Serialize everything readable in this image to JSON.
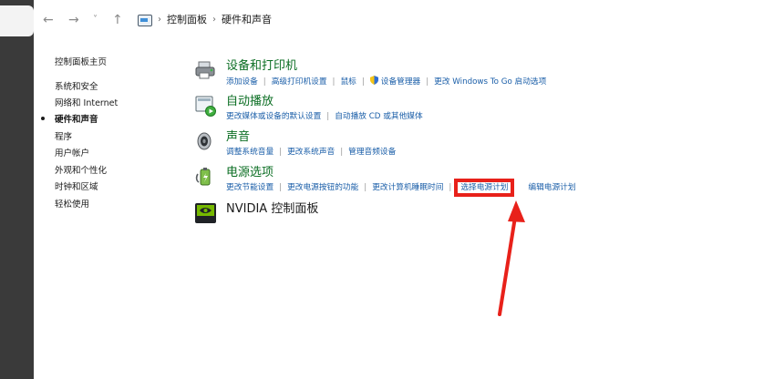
{
  "window": {
    "breadcrumb": [
      "控制面板",
      "硬件和声音"
    ],
    "nav": {
      "back": "←",
      "forward": "→",
      "recent": "˅",
      "up": "↑"
    }
  },
  "sidebar": {
    "items": [
      {
        "label": "控制面板主页",
        "current": false
      },
      {
        "label": "系统和安全",
        "current": false
      },
      {
        "label": "网络和 Internet",
        "current": false
      },
      {
        "label": "硬件和声音",
        "current": true
      },
      {
        "label": "程序",
        "current": false
      },
      {
        "label": "用户帐户",
        "current": false
      },
      {
        "label": "外观和个性化",
        "current": false
      },
      {
        "label": "时钟和区域",
        "current": false
      },
      {
        "label": "轻松使用",
        "current": false
      }
    ]
  },
  "categories": [
    {
      "title": "设备和打印机",
      "icon": "printer-icon",
      "links": [
        "添加设备",
        "高级打印机设置",
        "鼠标",
        "设备管理器",
        "更改 Windows To Go 启动选项"
      ]
    },
    {
      "title": "自动播放",
      "icon": "autoplay-icon",
      "links": [
        "更改媒体或设备的默认设置",
        "自动播放 CD 或其他媒体"
      ]
    },
    {
      "title": "声音",
      "icon": "speaker-icon",
      "links": [
        "调整系统音量",
        "更改系统声音",
        "管理音频设备"
      ]
    },
    {
      "title": "电源选项",
      "icon": "power-options-icon",
      "links": [
        "更改节能设置",
        "更改电源按钮的功能",
        "更改计算机睡眠时间",
        "选择电源计划",
        "编辑电源计划"
      ]
    },
    {
      "title": "NVIDIA 控制面板",
      "icon": "nvidia-icon",
      "links": []
    }
  ],
  "colors": {
    "link": "#1a5ea8",
    "category_title": "#0b6e23",
    "annotation": "#e8211a",
    "frame": "#3a3a3a"
  }
}
